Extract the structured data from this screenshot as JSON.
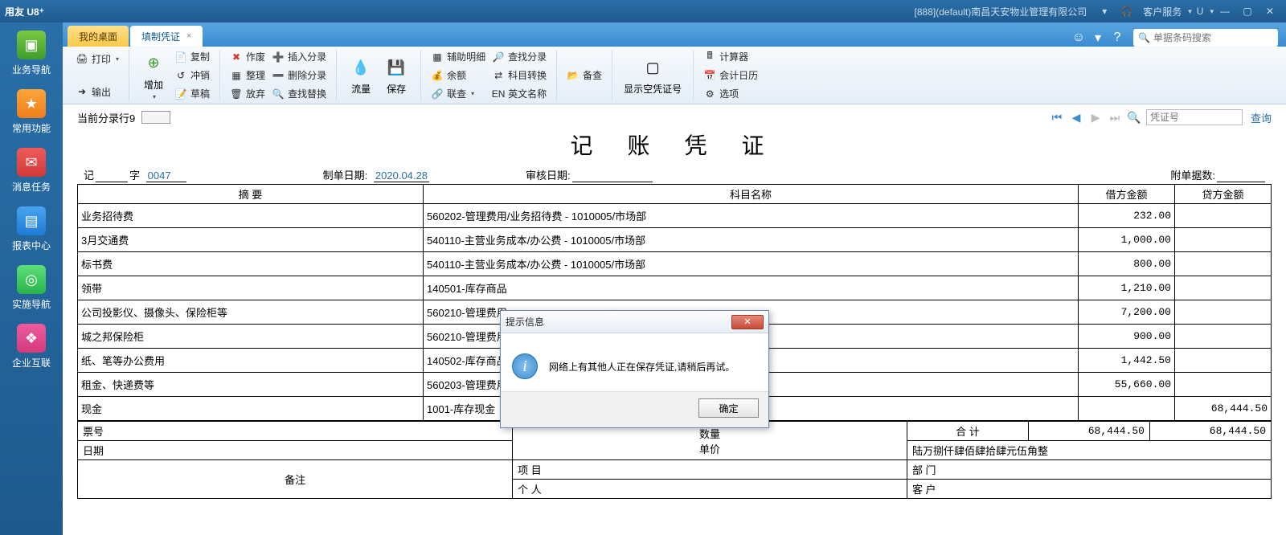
{
  "titlebar": {
    "app_name": "用友 U8⁺",
    "context": "[888](default)南昌天安物业管理有限公司",
    "service_label": "客户服务",
    "u_label": "U"
  },
  "leftnav": {
    "items": [
      {
        "label": "业务导航"
      },
      {
        "label": "常用功能"
      },
      {
        "label": "消息任务"
      },
      {
        "label": "报表中心"
      },
      {
        "label": "实施导航"
      },
      {
        "label": "企业互联"
      }
    ]
  },
  "tabs": {
    "desktop": "我的桌面",
    "voucher_entry": "填制凭证",
    "search_placeholder": "单据条码搜索"
  },
  "ribbon": {
    "print": "打印",
    "output": "输出",
    "add": "增加",
    "copy": "复制",
    "offset": "冲销",
    "draft": "草稿",
    "void": "作废",
    "tidy": "整理",
    "discard": "放弃",
    "insert_line": "插入分录",
    "delete_line": "删除分录",
    "find_replace": "查找替换",
    "flow": "流量",
    "save": "保存",
    "backup": "备查",
    "aux_detail": "辅助明细",
    "balance": "余额",
    "lookup": "联查",
    "find_entry": "查找分录",
    "subject_convert": "科目转换",
    "english_name": "英文名称",
    "show_empty_no": "显示空凭证号",
    "calculator": "计算器",
    "calendar": "会计日历",
    "options": "选项"
  },
  "nav": {
    "current_line": "当前分录行9",
    "voucher_no_placeholder": "凭证号",
    "query": "查询"
  },
  "voucher": {
    "title": "记 账 凭 证",
    "prefix_label": "记",
    "word_label": "字",
    "voucher_no": "0047",
    "prepared_date_label": "制单日期:",
    "prepared_date": "2020.04.28",
    "audit_date_label": "审核日期:",
    "attachments_label": "附单据数:",
    "headers": {
      "summary": "摘 要",
      "subject": "科目名称",
      "debit": "借方金额",
      "credit": "贷方金额"
    },
    "rows": [
      {
        "summary": "业务招待费",
        "subject": "560202-管理费用/业务招待费 - 1010005/市场部",
        "debit": "232.00",
        "credit": ""
      },
      {
        "summary": "3月交通费",
        "subject": "540110-主营业务成本/办公费 - 1010005/市场部",
        "debit": "1,000.00",
        "credit": ""
      },
      {
        "summary": "标书费",
        "subject": "540110-主营业务成本/办公费 - 1010005/市场部",
        "debit": "800.00",
        "credit": ""
      },
      {
        "summary": "领带",
        "subject": "140501-库存商品",
        "debit": "1,210.00",
        "credit": ""
      },
      {
        "summary": "公司投影仪、摄像头、保险柜等",
        "subject": "560210-管理费用",
        "debit": "7,200.00",
        "credit": ""
      },
      {
        "summary": "城之邦保险柜",
        "subject": "560210-管理费用",
        "debit": "900.00",
        "credit": ""
      },
      {
        "summary": "纸、笔等办公费用",
        "subject": "140502-库存商品",
        "debit": "1,442.50",
        "credit": ""
      },
      {
        "summary": "租金、快递费等",
        "subject": "560203-管理费用",
        "debit": "55,660.00",
        "credit": ""
      },
      {
        "summary": "现金",
        "subject": "1001-库存现金",
        "debit": "",
        "credit": "68,444.50"
      }
    ],
    "footer": {
      "bill_no": "票号",
      "date": "日期",
      "qty": "数量",
      "unit_price": "单价",
      "total": "合 计",
      "total_debit": "68,444.50",
      "total_credit": "68,444.50",
      "cn_amount": "陆万捌仟肆佰肆拾肆元伍角整",
      "remark": "备注",
      "project": "项 目",
      "dept": "部 门",
      "person": "个 人",
      "customer": "客 户"
    }
  },
  "modal": {
    "title": "提示信息",
    "message": "网络上有其他人正在保存凭证,请稍后再试。",
    "ok": "确定"
  }
}
